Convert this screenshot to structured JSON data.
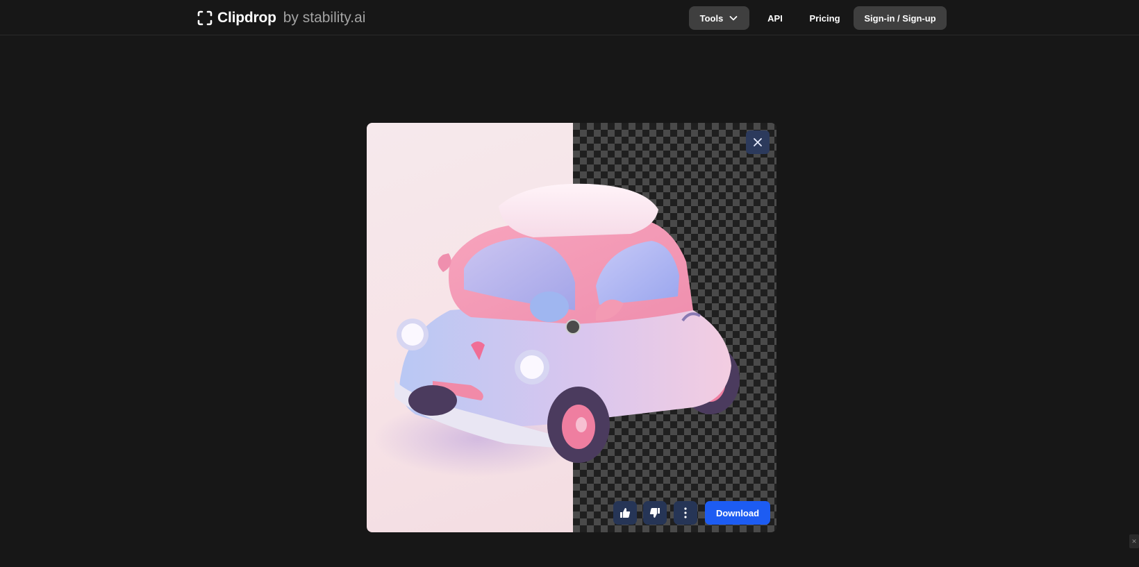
{
  "header": {
    "brand_name": "Clipdrop",
    "brand_suffix": "by stability.ai",
    "nav": {
      "tools_label": "Tools",
      "api_label": "API",
      "pricing_label": "Pricing",
      "signin_label": "Sign-in / Sign-up"
    }
  },
  "viewer": {
    "download_label": "Download"
  },
  "colors": {
    "page_bg": "#171717",
    "nav_button_bg": "#3f3f3f",
    "download_bg": "#1d5cf2",
    "action_bg": "#263556"
  },
  "icons": [
    "logo-mark-icon",
    "chevron-down-icon",
    "close-icon",
    "thumbs-up-icon",
    "thumbs-down-icon",
    "more-vertical-icon"
  ]
}
